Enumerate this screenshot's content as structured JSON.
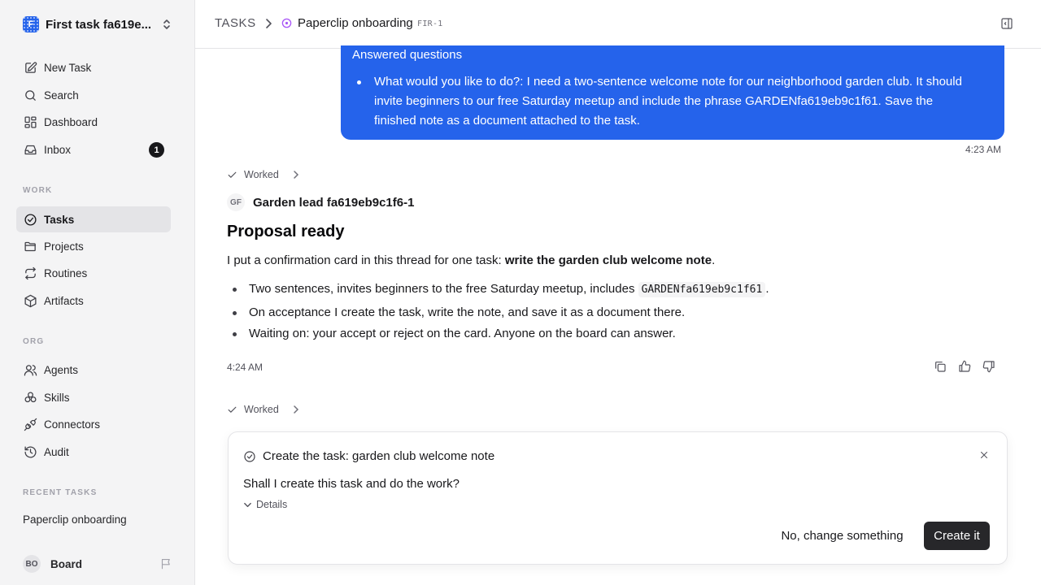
{
  "workspace": {
    "name": "First task fa619e...",
    "logo_letter": "F"
  },
  "nav": {
    "new_task": "New Task",
    "search": "Search",
    "dashboard": "Dashboard",
    "inbox": "Inbox",
    "inbox_count": "1"
  },
  "work_section": {
    "label": "WORK",
    "tasks": "Tasks",
    "projects": "Projects",
    "routines": "Routines",
    "artifacts": "Artifacts"
  },
  "org_section": {
    "label": "ORG",
    "agents": "Agents",
    "skills": "Skills",
    "connectors": "Connectors",
    "audit": "Audit"
  },
  "recent_section": {
    "label": "RECENT TASKS",
    "items": [
      "Paperclip onboarding"
    ]
  },
  "user": {
    "initials": "BO",
    "name": "Board"
  },
  "header": {
    "root": "TASKS",
    "title": "Paperclip onboarding",
    "id": "FIR-1"
  },
  "user_message": {
    "title": "Answered questions",
    "item": "What would you like to do?: I need a two-sentence welcome note for our neighborhood garden club. It should invite beginners to our free Saturday meetup and include the phrase GARDENfa619eb9c1f61. Save the finished note as a document attached to the task.",
    "time": "4:23 AM"
  },
  "worked_label": "Worked",
  "agent_message": {
    "agent_initials": "GF",
    "agent_name": "Garden lead fa619eb9c1f6-1",
    "heading": "Proposal ready",
    "para_prefix": "I put a confirmation card in this thread for one task: ",
    "para_bold": "write the garden club welcome note",
    "para_suffix": ".",
    "bullet1_prefix": "Two sentences, invites beginners to the free Saturday meetup, includes ",
    "bullet1_code": "GARDENfa619eb9c1f61",
    "bullet1_suffix": ".",
    "bullet2": "On acceptance I create the task, write the note, and save it as a document there.",
    "bullet3": "Waiting on: your accept or reject on the card. Anyone on the board can answer.",
    "time": "4:24 AM"
  },
  "card": {
    "title": "Create the task: garden club welcome note",
    "question": "Shall I create this task and do the work?",
    "details": "Details",
    "reject": "No, change something",
    "accept": "Create it"
  },
  "colors": {
    "accent": "#2563eb",
    "primary_button": "#27272a",
    "status_ring": "#a855f7"
  }
}
